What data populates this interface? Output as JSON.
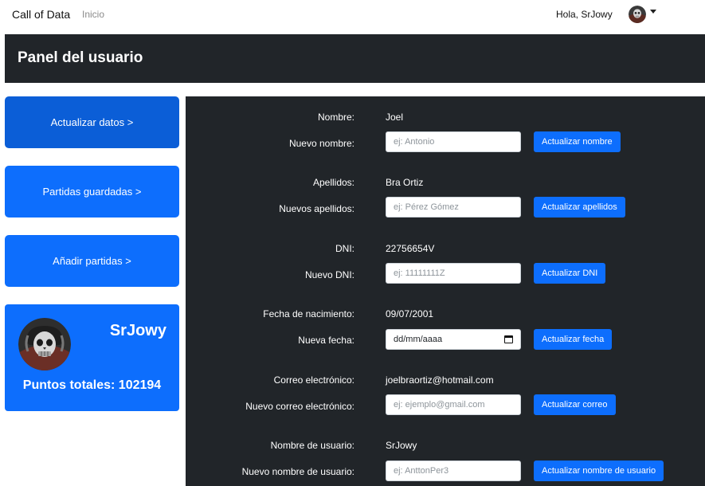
{
  "navbar": {
    "brand": "Call of Data",
    "link_inicio": "Inicio",
    "greeting": "Hola, SrJowy"
  },
  "header": {
    "title": "Panel del usuario"
  },
  "menu": {
    "update": "Actualizar datos >",
    "saved": "Partidas guardadas >",
    "add": "Añadir partidas >"
  },
  "profile": {
    "username": "SrJowy",
    "points": "Puntos totales: 102194"
  },
  "form": {
    "nombre": {
      "label": "Nombre:",
      "value": "Joel",
      "new_label": "Nuevo nombre:",
      "placeholder": "ej: Antonio",
      "button": "Actualizar nombre"
    },
    "apellidos": {
      "label": "Apellidos:",
      "value": "Bra Ortiz",
      "new_label": "Nuevos apellidos:",
      "placeholder": "ej: Pérez Gómez",
      "button": "Actualizar apellidos"
    },
    "dni": {
      "label": "DNI:",
      "value": "22756654V",
      "new_label": "Nuevo DNI:",
      "placeholder": "ej: 11111111Z",
      "button": "Actualizar DNI"
    },
    "fecha": {
      "label": "Fecha de nacimiento:",
      "value": "09/07/2001",
      "new_label": "Nueva fecha:",
      "placeholder": "dd/mm/aaaa",
      "button": "Actualizar fecha"
    },
    "correo": {
      "label": "Correo electrónico:",
      "value": "joelbraortiz@hotmail.com",
      "new_label": "Nuevo correo electrónico:",
      "placeholder": "ej: ejemplo@gmail.com",
      "button": "Actualizar correo"
    },
    "usuario": {
      "label": "Nombre de usuario:",
      "value": "SrJowy",
      "new_label": "Nuevo nombre de usuario:",
      "placeholder": "ej: AnttonPer3",
      "button": "Actualizar nombre de usuario"
    }
  },
  "colors": {
    "primary": "#0d6efd",
    "primary_active": "#0b5ed7",
    "dark_panel": "#212529"
  }
}
